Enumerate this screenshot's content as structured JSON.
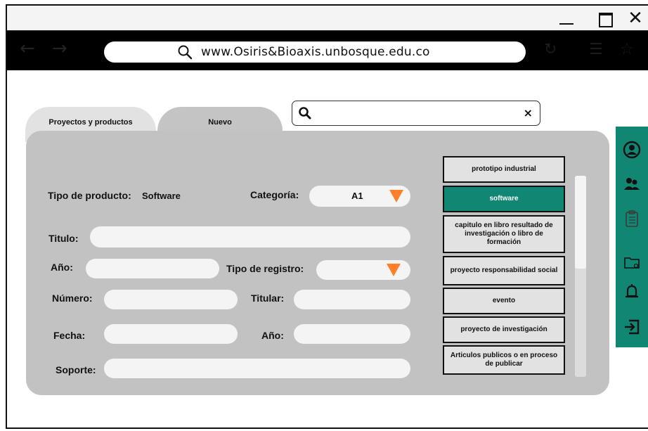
{
  "browser": {
    "url": "www.Osiris&Bioaxis.unbosque.edu.co"
  },
  "tabs": {
    "projects_label": "Proyectos y productos",
    "new_label": "Nuevo"
  },
  "search": {
    "value": "",
    "placeholder": "",
    "clear_symbol": "×"
  },
  "form": {
    "tipo_label": "Tipo de producto:",
    "tipo_value": "Software",
    "categoria_label": "Categoría:",
    "categoria_value": "A1",
    "titulo_label": "Titulo:",
    "anio_label": "Año:",
    "tipo_registro_label": "Tipo de registro:",
    "numero_label": "Número:",
    "titular_label": "Titular:",
    "fecha_label": "Fecha:",
    "anio2_label": "Año:",
    "soporte_label": "Soporte:"
  },
  "product_list": [
    {
      "label": "prototipo industrial",
      "active": false
    },
    {
      "label": "software",
      "active": true
    },
    {
      "label": "capitulo en libro resultado de investigación o libro de formación",
      "active": false
    },
    {
      "label": "proyecto responsabilidad social",
      "active": false
    },
    {
      "label": "evento",
      "active": false
    },
    {
      "label": "proyecto de investigación",
      "active": false
    },
    {
      "label": "Articulos publicos o en proceso de publicar",
      "active": false
    }
  ],
  "sidebar_icons": [
    "user-icon",
    "group-icon",
    "clipboard-icon",
    "folder-icon",
    "bell-icon",
    "logout-icon"
  ],
  "colors": {
    "accent": "#118673",
    "dropdown_arrow": "#ff7f2a",
    "panel": "#c2c2c2"
  }
}
